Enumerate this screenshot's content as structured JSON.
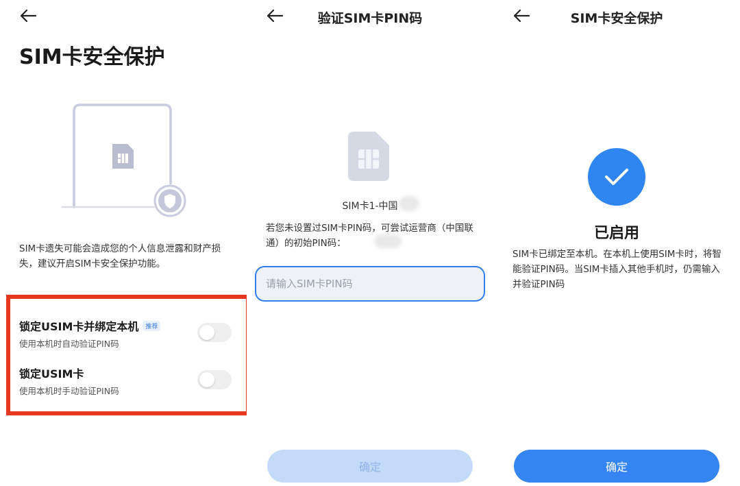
{
  "screen1": {
    "title": "SIM卡安全保护",
    "description": "SIM卡遗失可能会造成您的个人信息泄露和财产损失，建议开启SIM卡安全保护功能。",
    "options": [
      {
        "title": "锁定USIM卡并绑定本机",
        "tag": "推荐",
        "subtitle": "使用本机时自动验证PIN码",
        "enabled": false
      },
      {
        "title": "锁定USIM卡",
        "subtitle": "使用本机时手动验证PIN码",
        "enabled": false
      }
    ]
  },
  "screen2": {
    "title": "验证SIM卡PIN码",
    "sim_label": "SIM卡1-中国",
    "hint": "若您未设置过SIM卡PIN码，可尝试运营商（中国联通）的初始PIN码：",
    "pin_placeholder": "请输入SIM卡PIN码",
    "confirm_label": "确定"
  },
  "screen3": {
    "title": "SIM卡安全保护",
    "status": "已启用",
    "description": "SIM卡已绑定至本机。在本机上使用SIM卡时，将智能验证PIN码。当SIM卡插入其他手机时，仍需输入并验证PIN码",
    "confirm_label": "确定"
  },
  "colors": {
    "accent": "#3485f3",
    "highlight_border": "#e5391f",
    "disabled_button": "#c4daf9"
  },
  "icons": [
    "back-arrow-icon",
    "sim-card-icon",
    "shield-icon",
    "checkmark-icon"
  ]
}
